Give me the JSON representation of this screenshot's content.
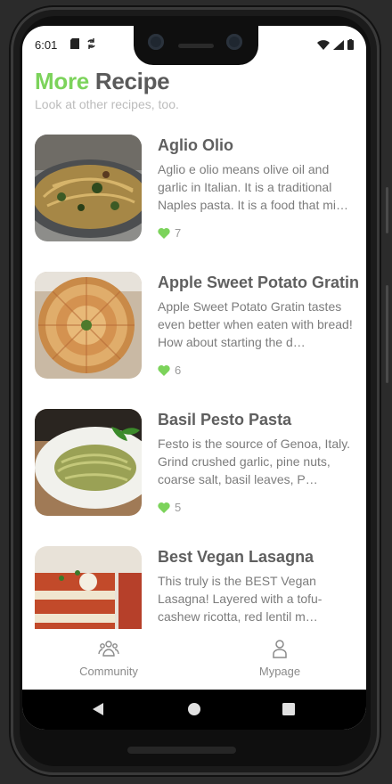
{
  "status_bar": {
    "time": "6:01"
  },
  "header": {
    "title_highlight": "More",
    "title_rest": "Recipe",
    "subtitle": "Look at other recipes, too."
  },
  "recipes": [
    {
      "name": "Aglio Olio",
      "description": "Aglio e olio means olive oil and garlic in Italian. It is a traditional Naples pasta. It is a food that mi…",
      "likes": "7"
    },
    {
      "name": "Apple Sweet Potato Gratin",
      "description": "Apple Sweet Potato Gratin tastes even better when eaten with bread! How about starting the d…",
      "likes": "6"
    },
    {
      "name": "Basil Pesto Pasta",
      "description": "Festo is the source of Genoa, Italy. Grind crushed garlic, pine nuts, coarse salt, basil leaves, P…",
      "likes": "5"
    },
    {
      "name": "Best Vegan Lasagna",
      "description": "This truly is the BEST Vegan Lasagna! Layered with a tofu-cashew ricotta, red lentil m…",
      "likes": ""
    }
  ],
  "bottom_nav": {
    "community": "Community",
    "mypage": "Mypage"
  },
  "colors": {
    "accent": "#7cd35b",
    "heart": "#7cd35b",
    "title_gray": "#5a5a5a"
  }
}
